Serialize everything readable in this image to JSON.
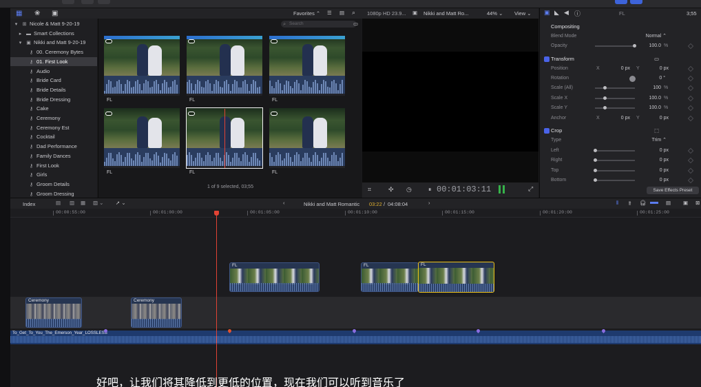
{
  "browser": {
    "favorites_label": "Favorites",
    "search_placeholder": "Search",
    "status": "1 of 9 selected, 03;55",
    "clip_labels": [
      "FL",
      "FL",
      "FL",
      "FL",
      "FL",
      "FL"
    ]
  },
  "library": {
    "root": "Nicole & Matt 9-20-19",
    "items": [
      {
        "label": "Smart Collections",
        "icon": "folder-icon"
      },
      {
        "label": "Nikki and Matt 9-20-19",
        "icon": "event-icon"
      },
      {
        "label": "00. Ceremony Bytes",
        "icon": "keyword-icon"
      },
      {
        "label": "01. First Look",
        "icon": "keyword-icon",
        "selected": true
      },
      {
        "label": "Audio",
        "icon": "keyword-icon"
      },
      {
        "label": "Bride Card",
        "icon": "keyword-icon"
      },
      {
        "label": "Bride Details",
        "icon": "keyword-icon"
      },
      {
        "label": "Bride Dressing",
        "icon": "keyword-icon"
      },
      {
        "label": "Cake",
        "icon": "keyword-icon"
      },
      {
        "label": "Ceremony",
        "icon": "keyword-icon"
      },
      {
        "label": "Ceremony Est",
        "icon": "keyword-icon"
      },
      {
        "label": "Cocktail",
        "icon": "keyword-icon"
      },
      {
        "label": "Dad Performance",
        "icon": "keyword-icon"
      },
      {
        "label": "Family Dances",
        "icon": "keyword-icon"
      },
      {
        "label": "First Look",
        "icon": "keyword-icon"
      },
      {
        "label": "Girls",
        "icon": "keyword-icon"
      },
      {
        "label": "Groom Details",
        "icon": "keyword-icon"
      },
      {
        "label": "Groom Dressing",
        "icon": "keyword-icon"
      }
    ]
  },
  "viewer": {
    "format": "1080p HD 23.9...",
    "clip_name": "Nikki and Matt Ro...",
    "zoom": "44%",
    "view_label": "View",
    "timecode": "00:01:03:11"
  },
  "inspector": {
    "clip_label": "FL",
    "duration": "3;55",
    "compositing": "Compositing",
    "blend_mode_label": "Blend Mode",
    "blend_mode_value": "Normal",
    "opacity_label": "Opacity",
    "opacity_value": "100.0",
    "opacity_unit": "%",
    "transform": "Transform",
    "position_label": "Position",
    "position_x": "0 px",
    "position_y": "0 px",
    "rotation_label": "Rotation",
    "rotation_value": "0 °",
    "scale_all_label": "Scale (All)",
    "scale_all_value": "100",
    "scale_x_label": "Scale X",
    "scale_x_value": "100.0",
    "scale_y_label": "Scale Y",
    "scale_y_value": "100.0",
    "anchor_label": "Anchor",
    "anchor_x": "0 px",
    "anchor_y": "0 px",
    "crop": "Crop",
    "type_label": "Type",
    "type_value": "Trim",
    "left_label": "Left",
    "left_value": "0 px",
    "right_label": "Right",
    "right_value": "0 px",
    "top_label": "Top",
    "top_value": "0 px",
    "bottom_label": "Bottom",
    "bottom_value": "0 px",
    "save_preset": "Save Effects Preset",
    "axis_x": "X",
    "axis_y": "Y",
    "pct": "%"
  },
  "timeline": {
    "index_label": "Index",
    "project_name": "Nikki and Matt Romantic",
    "position": "03:22",
    "total": "04:08:04",
    "ruler": [
      "00:00:55:00",
      "00:01:00:00",
      "00:01:05:00",
      "00:01:10:00",
      "00:01:15:00",
      "00:01:20:00",
      "00:01:25:00"
    ],
    "connected_clips": [
      "FL",
      "FL",
      "FL"
    ],
    "primary_clips": [
      "Ceremony",
      "Ceremony"
    ],
    "music_title": "To_Get_To_You_The_Emerson_Year_LOSSLESS"
  },
  "subtitle": "好吧，让我们将其降低到更低的位置，现在我们可以听到音乐了"
}
